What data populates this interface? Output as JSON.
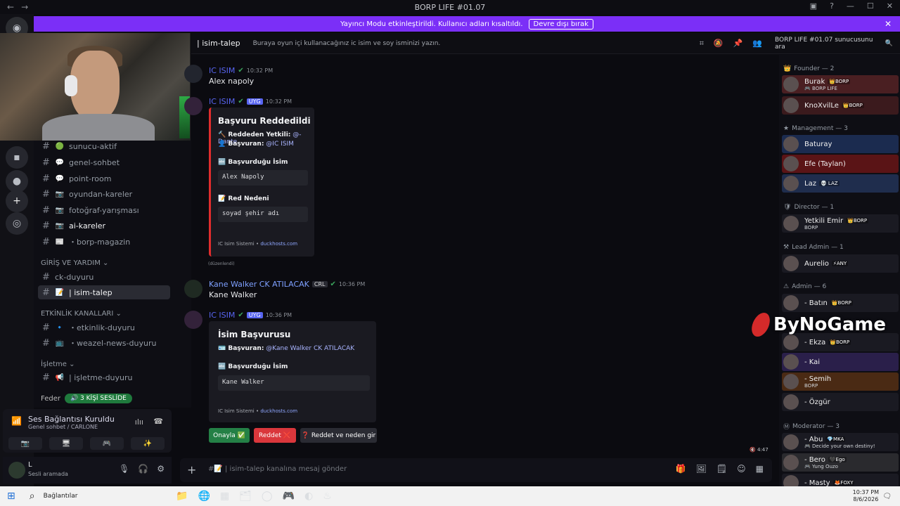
{
  "window": {
    "title": "BORP LIFE #01.07",
    "nav_back": "←",
    "nav_forward": "→",
    "controls": [
      "▣",
      "?",
      "—",
      "☐",
      "✕"
    ]
  },
  "notice": {
    "text": "Yayıncı Modu etkinleştirildi. Kullanıcı adları kısaltıldı.",
    "button": "Devre dışı bırak",
    "close": "✕"
  },
  "channel_header": {
    "name": "| isim-talep",
    "topic": "Buraya oyun içi kullanacağınız ic isim ve soy isminizi yazın.",
    "search_placeholder": "BORP LIFE #01.07 sunucusunu ara"
  },
  "channels": [
    {
      "emoji": "🟢",
      "name": "sunucu-aktif"
    },
    {
      "emoji": "💬",
      "name": "genel-sohbet"
    },
    {
      "emoji": "💬",
      "name": "point-room"
    },
    {
      "emoji": "📷",
      "name": "oyundan-kareler"
    },
    {
      "emoji": "📷",
      "name": "fotoğraf-yarışması"
    },
    {
      "emoji": "📷",
      "name": "ai-kareler"
    },
    {
      "emoji": "📰",
      "name": "・borp-magazin"
    }
  ],
  "category_help": "GİRİŞ VE YARDIM",
  "help_channels": [
    {
      "emoji": "",
      "name": "ck-duyuru"
    },
    {
      "emoji": "📝",
      "name": "| isim-talep"
    }
  ],
  "category_events": "ETKİNLİK KANALLARI",
  "event_channels": [
    {
      "emoji": "🔹",
      "name": "・etkinlik-duyuru"
    },
    {
      "emoji": "📺",
      "name": "・weazel-news-duyuru"
    }
  ],
  "category_business": "İşletme",
  "business_channels": [
    {
      "emoji": "📢",
      "name": "| işletme-duyuru"
    }
  ],
  "federation": {
    "label": "Feder",
    "voice_pill": "3 KİŞİ SESLİDE"
  },
  "voice_panel": {
    "status": "Ses Bağlantısı Kuruldu",
    "channel": "Genel sohbet / CARLONE",
    "buttons": [
      "📷",
      "🖥",
      "🎮",
      "✨"
    ]
  },
  "user_panel": {
    "name": "L",
    "status": "Sesli aramada"
  },
  "messages": [
    {
      "author": "IC ISIM",
      "badge": "",
      "time": "10:32 PM",
      "text": "Alex napoly"
    },
    {
      "author": "IC ISIM",
      "badge": "UYG",
      "time": "10:32 PM",
      "embed": {
        "title": "Başvuru Reddedildi",
        "line1_label": "🔨 Reddeden Yetkili:",
        "line1_value": "@- Dante",
        "line2_label": "👤 Başvuran:",
        "line2_value": "@IC ISIM",
        "field1_title": "🔤 Başvurduğu İsim",
        "field1_value": "Alex Napoly",
        "field2_title": "📝 Red Nedeni",
        "field2_value": "soyad şehir adı",
        "footer_a": "IC Isim Sistemi",
        "footer_sep": "•",
        "footer_b": "duckhosts.com"
      },
      "edited": "(düzenlendi)"
    },
    {
      "author": "Kane Walker CK ATILACAK",
      "badge": "CRL",
      "time": "10:36 PM",
      "text": "Kane Walker"
    },
    {
      "author": "IC ISIM",
      "badge": "UYG",
      "time": "10:36 PM",
      "embed": {
        "title": "İsim Başvurusu",
        "line1_label": "🪪 Başvuran:",
        "line1_value": "@Kane Walker CK ATILACAK",
        "field1_title": "🔤 Başvurduğu İsim",
        "field1_value": "Kane Walker",
        "footer_a": "IC Isim Sistemi",
        "footer_sep": "•",
        "footer_b": "duckhosts.com"
      }
    }
  ],
  "actions": {
    "approve": "Onayla ✅",
    "reject": "Reddet ❌",
    "reject_reason": "❓ Reddet ve neden gir"
  },
  "composer": {
    "placeholder": "#📝 | isim-talep kanalına mesaj gönder",
    "tools": [
      "🎁",
      "🖼",
      "🗒",
      "☺",
      "▦"
    ]
  },
  "members": {
    "cat_founder": "Founder — 2",
    "cat_management": "Management — 3",
    "cat_director": "Director — 1",
    "cat_lead_admin": "Lead Admin — 1",
    "cat_admin": "Admin — 6",
    "cat_moderator": "Moderator — 3",
    "founder": [
      {
        "name": "Burak",
        "role": "👑BORP",
        "sub": "🎮 BORP LIFE",
        "bg": "#4a1f22"
      },
      {
        "name": "KnoXvilLe",
        "role": "👑BORP",
        "sub": "",
        "bg": "#3b1a1d"
      }
    ],
    "management": [
      {
        "name": "Baturay",
        "role": "",
        "sub": "",
        "bg": "#1b2b4f"
      },
      {
        "name": "Efe (Taylan)",
        "role": "",
        "sub": "",
        "bg": "#5a1416"
      },
      {
        "name": "Laz",
        "role": "💀 LAZ",
        "sub": "",
        "bg": "#1f2d4d"
      }
    ],
    "director": [
      {
        "name": "Yetkili Emir",
        "role": "👑BORP",
        "sub": "BORP",
        "bg": "#1a1a22"
      }
    ],
    "lead_admin": [
      {
        "name": "Aurelio",
        "role": "⚡ANY",
        "sub": "",
        "bg": "#1a1a22"
      }
    ],
    "admin": [
      {
        "name": "- Batın",
        "role": "👑BORP",
        "sub": "",
        "bg": "#1a1a22"
      },
      {
        "name": "- Ekza",
        "role": "👑BORP",
        "sub": "",
        "bg": "#1a1a22"
      },
      {
        "name": "- Kai",
        "role": "",
        "sub": "",
        "bg": "#2a1f4a"
      },
      {
        "name": "- Semih",
        "role": "",
        "sub": "BORP",
        "bg": "#4a2a14"
      },
      {
        "name": "- Özgür",
        "role": "",
        "sub": "",
        "bg": "#1a1a22"
      }
    ],
    "moderator": [
      {
        "name": "- Abu",
        "role": "💎MKA",
        "sub": "🎮 Decide your own destiny!",
        "bg": "#1a1a22"
      },
      {
        "name": "- Bero",
        "role": "🖤Ego",
        "sub": "🎮 Yung Ouzo",
        "bg": "#2a2a2e"
      },
      {
        "name": "- Masty",
        "role": "🦊FOXY",
        "sub": "",
        "bg": "#1a1a22"
      }
    ]
  },
  "watermark": "ByNoGame",
  "timer": "🔇 4:47",
  "taskbar": {
    "label": "Bağlantılar",
    "time": "10:37 PM",
    "date": "8/6/2026",
    "apps": [
      "📁",
      "🌐",
      "▦",
      "🗂",
      "◯",
      "🎮",
      "◐",
      "♨"
    ]
  },
  "colors": {
    "accent": "#7b2ff7",
    "mention": "#5865f2",
    "approve": "#248046",
    "reject": "#da373c",
    "neutral": "#2a2b33"
  }
}
